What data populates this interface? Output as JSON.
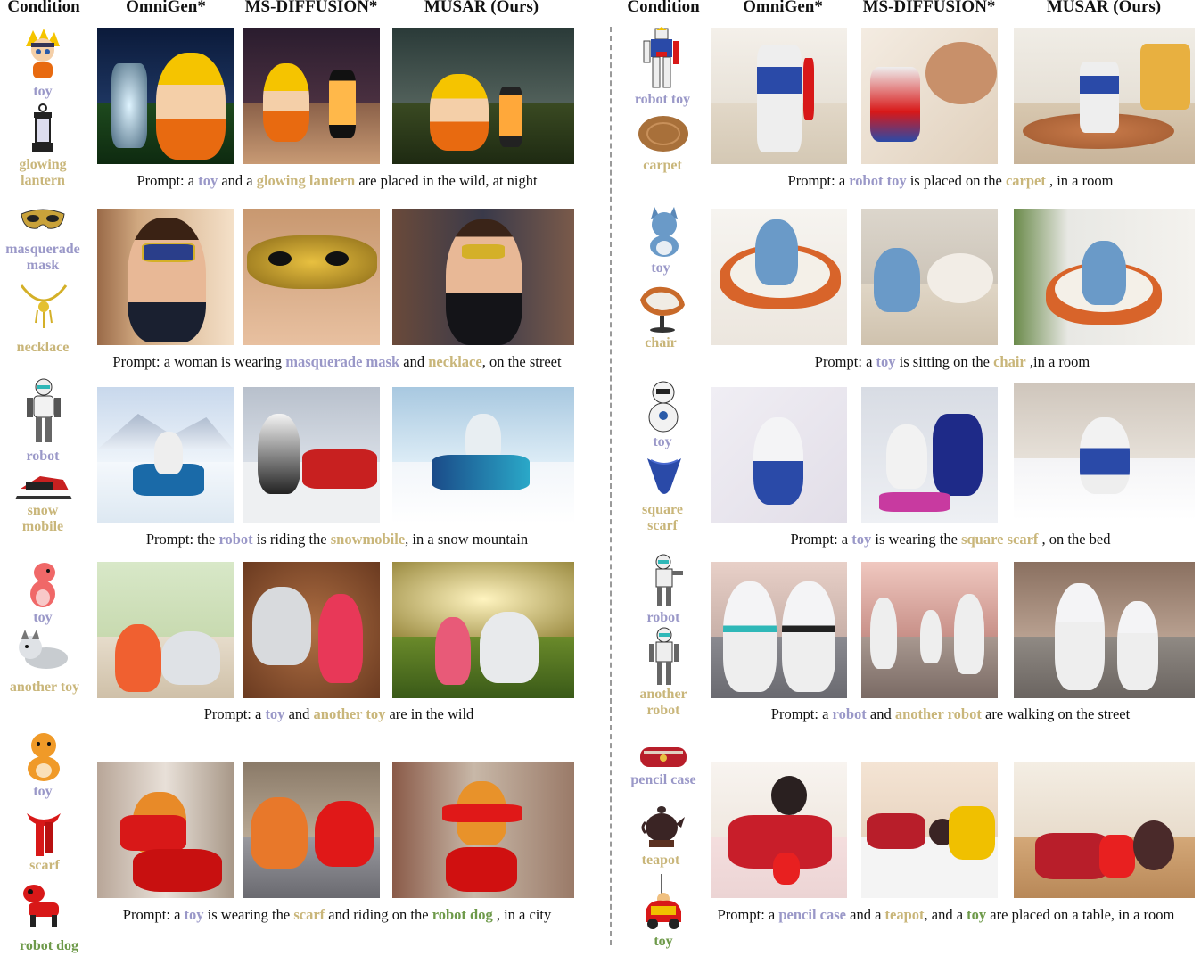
{
  "headers": {
    "left": [
      "Condition",
      "OmniGen*",
      "MS-DIFFUSION*",
      "MUSAR (Ours)"
    ],
    "right": [
      "Condition",
      "OmniGen*",
      "MS-DIFFUSION*",
      "MUSAR (Ours)"
    ]
  },
  "rows": [
    {
      "conditions": [
        {
          "label": "toy",
          "color": "#9a98c8",
          "icon": "naruto-toy-icon"
        },
        {
          "label": "glowing lantern",
          "color": "#c9b67a",
          "icon": "lantern-icon"
        }
      ],
      "prompt": {
        "p0": "Prompt: a ",
        "s1": "toy",
        "p1": " and a ",
        "s2": "glowing lantern",
        "p2": " are placed in the wild, at night",
        "s3": "",
        "p3": ""
      }
    },
    {
      "conditions": [
        {
          "label": "masquerade mask",
          "color": "#9a98c8",
          "icon": "mask-icon"
        },
        {
          "label": "necklace",
          "color": "#c9b67a",
          "icon": "necklace-icon"
        }
      ],
      "prompt": {
        "p0": "Prompt: a woman is wearing ",
        "s1": "masquerade mask",
        "p1": " and ",
        "s2": "necklace",
        "p2": ", on the street",
        "s3": "",
        "p3": ""
      }
    },
    {
      "conditions": [
        {
          "label": "robot",
          "color": "#9a98c8",
          "icon": "robot-icon"
        },
        {
          "label": "snow mobile",
          "color": "#c9b67a",
          "icon": "snowmobile-icon"
        }
      ],
      "prompt": {
        "p0": "Prompt: the ",
        "s1": "robot",
        "p1": " is riding the ",
        "s2": "snowmobile",
        "p2": ", in a snow mountain",
        "s3": "",
        "p3": ""
      }
    },
    {
      "conditions": [
        {
          "label": "toy",
          "color": "#9a98c8",
          "icon": "dinosaur-toy-icon"
        },
        {
          "label": "another toy",
          "color": "#c9b67a",
          "icon": "husky-toy-icon"
        }
      ],
      "prompt": {
        "p0": "Prompt: a ",
        "s1": "toy",
        "p1": " and ",
        "s2": "another toy",
        "p2": " are in the wild",
        "s3": "",
        "p3": ""
      }
    },
    {
      "conditions": [
        {
          "label": "toy",
          "color": "#9a98c8",
          "icon": "tiger-toy-icon"
        },
        {
          "label": "scarf",
          "color": "#c9b67a",
          "icon": "scarf-icon"
        },
        {
          "label": "robot dog",
          "color": "#6e9a4a",
          "icon": "robot-dog-icon"
        }
      ],
      "prompt": {
        "p0": "Prompt: a ",
        "s1": "toy",
        "p1": " is wearing the ",
        "s2": "scarf",
        "p2": " and riding on the ",
        "s3": "robot dog",
        "p3": " , in a city"
      }
    },
    {
      "conditions": [
        {
          "label": "robot toy",
          "color": "#9a98c8",
          "icon": "gundam-toy-icon"
        },
        {
          "label": "carpet",
          "color": "#c9b67a",
          "icon": "carpet-icon"
        }
      ],
      "prompt": {
        "p0": "Prompt: a ",
        "s1": "robot toy",
        "p1": " is placed on the ",
        "s2": "carpet",
        "p2": " , in a room",
        "s3": "",
        "p3": ""
      }
    },
    {
      "conditions": [
        {
          "label": "toy",
          "color": "#9a98c8",
          "icon": "cat-toy-icon"
        },
        {
          "label": "chair",
          "color": "#c9b67a",
          "icon": "chair-icon"
        }
      ],
      "prompt": {
        "p0": "Prompt: a ",
        "s1": "toy",
        "p1": " is sitting on the ",
        "s2": "chair",
        "p2": " ,in a room",
        "s3": "",
        "p3": ""
      }
    },
    {
      "conditions": [
        {
          "label": "toy",
          "color": "#9a98c8",
          "icon": "robot-toy-icon"
        },
        {
          "label": "square scarf",
          "color": "#c9b67a",
          "icon": "square-scarf-icon"
        }
      ],
      "prompt": {
        "p0": "Prompt: a ",
        "s1": "toy",
        "p1": " is wearing the ",
        "s2": "square scarf",
        "p2": " , on the bed",
        "s3": "",
        "p3": ""
      }
    },
    {
      "conditions": [
        {
          "label": "robot",
          "color": "#9a98c8",
          "icon": "robot-icon"
        },
        {
          "label": "another robot",
          "color": "#c9b67a",
          "icon": "robot-icon"
        }
      ],
      "prompt": {
        "p0": "Prompt: a ",
        "s1": "robot",
        "p1": " and ",
        "s2": "another robot",
        "p2": " are walking on the street",
        "s3": "",
        "p3": ""
      }
    },
    {
      "conditions": [
        {
          "label": "pencil case",
          "color": "#9a98c8",
          "icon": "pencil-case-icon"
        },
        {
          "label": "teapot",
          "color": "#c9b67a",
          "icon": "teapot-icon"
        },
        {
          "label": "toy",
          "color": "#6e9a4a",
          "icon": "car-toy-icon"
        }
      ],
      "prompt": {
        "p0": "Prompt: a ",
        "s1": "pencil case",
        "p1": " and a ",
        "s2": "teapot",
        "p2": ", and a ",
        "s3": "toy",
        "p3": " are placed on a table, in a room"
      }
    }
  ]
}
